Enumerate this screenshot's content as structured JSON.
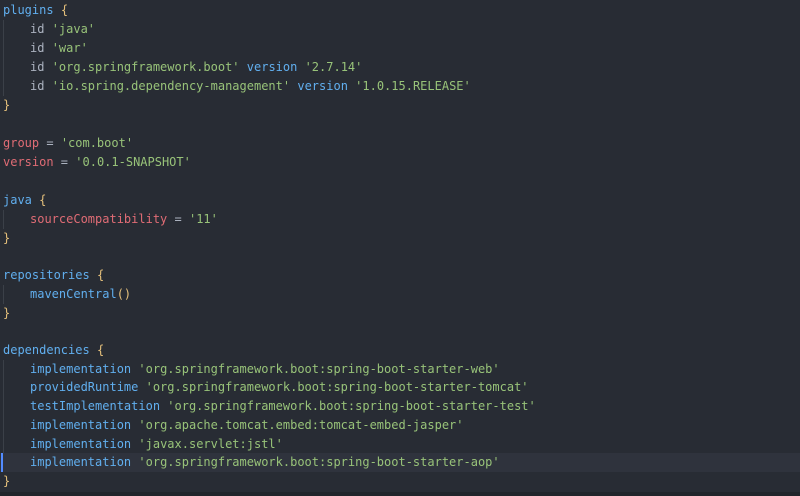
{
  "code": {
    "plugins_kw": "plugins",
    "open": "{",
    "close": "}",
    "id_kw": "id",
    "plugin_java": "'java'",
    "plugin_war": "'war'",
    "plugin_boot": "'org.springframework.boot'",
    "version_kw": "version",
    "plugin_boot_version": "'2.7.14'",
    "plugin_dep": "'io.spring.dependency-management'",
    "plugin_dep_version": "'1.0.15.RELEASE'",
    "group_kw": "group",
    "eq": " = ",
    "group_val": "'com.boot'",
    "version_val": "'0.0.1-SNAPSHOT'",
    "java_kw": "java",
    "sourcecompat_kw": "sourceCompatibility",
    "sourcecompat_val": "'11'",
    "repositories_kw": "repositories",
    "mavencentral_kw": "mavenCentral",
    "parens": "()",
    "dependencies_kw": "dependencies",
    "implementation_kw": "implementation",
    "provided_kw": "providedRuntime",
    "testimpl_kw": "testImplementation",
    "dep_web": "'org.springframework.boot:spring-boot-starter-web'",
    "dep_tomcat": "'org.springframework.boot:spring-boot-starter-tomcat'",
    "dep_test": "'org.springframework.boot:spring-boot-starter-test'",
    "dep_jasper": "'org.apache.tomcat.embed:tomcat-embed-jasper'",
    "dep_jstl": "'javax.servlet:jstl'",
    "dep_aop": "'org.springframework.boot:spring-boot-starter-aop'"
  },
  "colors": {
    "background": "#282c34",
    "keyword": "#61afef",
    "property": "#e06c75",
    "string": "#98c379",
    "brace": "#e5c07b",
    "current_line": "#2f333d"
  }
}
